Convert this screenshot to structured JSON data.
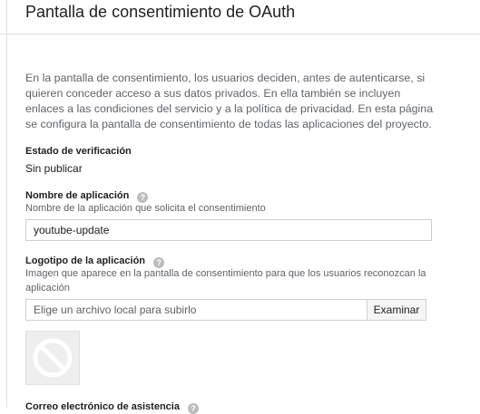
{
  "header": {
    "title": "Pantalla de consentimiento de OAuth"
  },
  "intro": {
    "text": "En la pantalla de consentimiento, los usuarios deciden, antes de autenticarse, si quieren conceder acceso a sus datos privados. En ella también se incluyen enlaces a las condiciones del servicio y a la política de privacidad. En esta página se configura la pantalla de consentimiento de todas las aplicaciones del proyecto."
  },
  "verification": {
    "label": "Estado de verificación",
    "value": "Sin publicar"
  },
  "app_name": {
    "label": "Nombre de aplicación",
    "hint": "Nombre de la aplicación que solicita el consentimiento",
    "value": "youtube-update",
    "help_icon": "help-circle-icon"
  },
  "app_logo": {
    "label": "Logotipo de la aplicación",
    "hint": "Imagen que aparece en la pantalla de consentimiento para que los usuarios reconozcan la aplicación",
    "file_placeholder": "Elige un archivo local para subirlo",
    "browse_label": "Examinar",
    "placeholder_icon": "no-image-icon",
    "help_icon": "help-circle-icon"
  },
  "support_email": {
    "label": "Correo electrónico de asistencia",
    "help_icon": "help-circle-icon"
  },
  "colors": {
    "border": "#e0e0e0",
    "text": "#212121",
    "muted": "#5f6368",
    "help_icon": "#bdbdbd"
  }
}
